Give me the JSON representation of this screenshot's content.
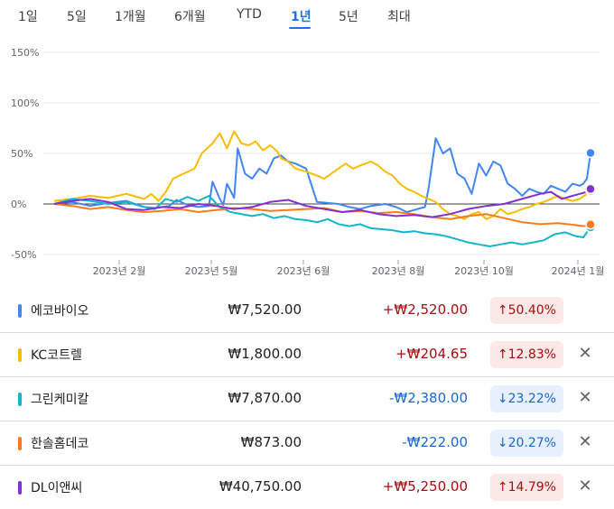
{
  "tabs": [
    {
      "label": "1일",
      "active": false
    },
    {
      "label": "5일",
      "active": false
    },
    {
      "label": "1개월",
      "active": false
    },
    {
      "label": "6개월",
      "active": false
    },
    {
      "label": "YTD",
      "active": false
    },
    {
      "label": "1년",
      "active": true
    },
    {
      "label": "5년",
      "active": false
    },
    {
      "label": "최대",
      "active": false
    }
  ],
  "chart_data": {
    "type": "line",
    "yticks": [
      "150%",
      "100%",
      "50%",
      "0%",
      "-50%"
    ],
    "ylim": [
      -50,
      150
    ],
    "x_labels": [
      "2023년 2월",
      "2023년 5월",
      "2023년 6월",
      "2023년 8월",
      "2023년 10월",
      "2024년 1월"
    ],
    "grid": true,
    "series": [
      {
        "name": "에코바이오",
        "color": "#4285f4",
        "points": [
          [
            0,
            0
          ],
          [
            5,
            2
          ],
          [
            10,
            -2
          ],
          [
            15,
            1
          ],
          [
            20,
            3
          ],
          [
            25,
            -3
          ],
          [
            28,
            -4
          ],
          [
            32,
            -2
          ],
          [
            34,
            4
          ],
          [
            37,
            -1
          ],
          [
            40,
            -3
          ],
          [
            43,
            -2
          ],
          [
            44,
            22
          ],
          [
            46,
            5
          ],
          [
            47,
            -1
          ],
          [
            48,
            20
          ],
          [
            50,
            6
          ],
          [
            51,
            55
          ],
          [
            53,
            30
          ],
          [
            55,
            25
          ],
          [
            57,
            35
          ],
          [
            59,
            30
          ],
          [
            61,
            45
          ],
          [
            63,
            48
          ],
          [
            65,
            42
          ],
          [
            67,
            40
          ],
          [
            70,
            35
          ],
          [
            73,
            2
          ],
          [
            76,
            1
          ],
          [
            79,
            0
          ],
          [
            82,
            -3
          ],
          [
            85,
            -5
          ],
          [
            88,
            -2
          ],
          [
            92,
            0
          ],
          [
            95,
            -3
          ],
          [
            98,
            -8
          ],
          [
            101,
            -5
          ],
          [
            103,
            -3
          ],
          [
            104,
            15
          ],
          [
            106,
            65
          ],
          [
            108,
            50
          ],
          [
            110,
            55
          ],
          [
            112,
            30
          ],
          [
            114,
            25
          ],
          [
            116,
            10
          ],
          [
            118,
            40
          ],
          [
            120,
            28
          ],
          [
            122,
            42
          ],
          [
            124,
            38
          ],
          [
            126,
            20
          ],
          [
            128,
            15
          ],
          [
            130,
            8
          ],
          [
            132,
            15
          ],
          [
            134,
            12
          ],
          [
            136,
            10
          ],
          [
            138,
            18
          ],
          [
            140,
            15
          ],
          [
            142,
            12
          ],
          [
            144,
            20
          ],
          [
            146,
            18
          ],
          [
            147,
            20
          ],
          [
            148,
            25
          ],
          [
            149,
            50.4
          ]
        ]
      },
      {
        "name": "KC코트렐",
        "color": "#fbbc04",
        "points": [
          [
            0,
            3
          ],
          [
            5,
            5
          ],
          [
            10,
            8
          ],
          [
            15,
            6
          ],
          [
            20,
            10
          ],
          [
            25,
            5
          ],
          [
            27,
            10
          ],
          [
            29,
            3
          ],
          [
            31,
            12
          ],
          [
            33,
            25
          ],
          [
            36,
            30
          ],
          [
            39,
            35
          ],
          [
            41,
            50
          ],
          [
            44,
            60
          ],
          [
            46,
            70
          ],
          [
            48,
            55
          ],
          [
            50,
            72
          ],
          [
            52,
            60
          ],
          [
            54,
            58
          ],
          [
            56,
            62
          ],
          [
            58,
            53
          ],
          [
            60,
            58
          ],
          [
            62,
            52
          ],
          [
            63,
            45
          ],
          [
            65,
            42
          ],
          [
            67,
            35
          ],
          [
            70,
            32
          ],
          [
            73,
            28
          ],
          [
            75,
            25
          ],
          [
            77,
            30
          ],
          [
            79,
            35
          ],
          [
            81,
            40
          ],
          [
            83,
            35
          ],
          [
            85,
            38
          ],
          [
            88,
            42
          ],
          [
            90,
            38
          ],
          [
            92,
            32
          ],
          [
            94,
            28
          ],
          [
            96,
            20
          ],
          [
            98,
            15
          ],
          [
            100,
            12
          ],
          [
            102,
            8
          ],
          [
            104,
            5
          ],
          [
            106,
            2
          ],
          [
            108,
            -5
          ],
          [
            110,
            -10
          ],
          [
            112,
            -12
          ],
          [
            114,
            -15
          ],
          [
            116,
            -10
          ],
          [
            118,
            -8
          ],
          [
            120,
            -15
          ],
          [
            122,
            -12
          ],
          [
            124,
            -5
          ],
          [
            126,
            -10
          ],
          [
            128,
            -8
          ],
          [
            130,
            -5
          ],
          [
            132,
            -3
          ],
          [
            134,
            0
          ],
          [
            136,
            2
          ],
          [
            138,
            5
          ],
          [
            140,
            8
          ],
          [
            142,
            5
          ],
          [
            144,
            3
          ],
          [
            146,
            5
          ],
          [
            148,
            10
          ],
          [
            149,
            12.83
          ]
        ]
      },
      {
        "name": "그린케미칼",
        "color": "#12b5cb",
        "points": [
          [
            0,
            0
          ],
          [
            5,
            5
          ],
          [
            10,
            3
          ],
          [
            15,
            0
          ],
          [
            20,
            2
          ],
          [
            25,
            -3
          ],
          [
            28,
            -5
          ],
          [
            31,
            5
          ],
          [
            34,
            2
          ],
          [
            37,
            7
          ],
          [
            40,
            3
          ],
          [
            43,
            8
          ],
          [
            46,
            -3
          ],
          [
            49,
            -8
          ],
          [
            52,
            -10
          ],
          [
            55,
            -12
          ],
          [
            58,
            -10
          ],
          [
            61,
            -14
          ],
          [
            64,
            -12
          ],
          [
            67,
            -15
          ],
          [
            70,
            -16
          ],
          [
            73,
            -18
          ],
          [
            76,
            -15
          ],
          [
            79,
            -20
          ],
          [
            82,
            -22
          ],
          [
            85,
            -20
          ],
          [
            88,
            -24
          ],
          [
            91,
            -25
          ],
          [
            94,
            -26
          ],
          [
            97,
            -28
          ],
          [
            100,
            -27
          ],
          [
            103,
            -29
          ],
          [
            106,
            -30
          ],
          [
            109,
            -32
          ],
          [
            112,
            -35
          ],
          [
            115,
            -38
          ],
          [
            118,
            -40
          ],
          [
            121,
            -42
          ],
          [
            124,
            -40
          ],
          [
            127,
            -38
          ],
          [
            130,
            -40
          ],
          [
            133,
            -38
          ],
          [
            136,
            -36
          ],
          [
            139,
            -30
          ],
          [
            142,
            -28
          ],
          [
            145,
            -32
          ],
          [
            147,
            -33
          ],
          [
            149,
            -23.22
          ]
        ]
      },
      {
        "name": "한솔홈데코",
        "color": "#fa7b17",
        "points": [
          [
            0,
            0
          ],
          [
            5,
            -2
          ],
          [
            10,
            -5
          ],
          [
            15,
            -3
          ],
          [
            20,
            -6
          ],
          [
            25,
            -8
          ],
          [
            30,
            -7
          ],
          [
            35,
            -5
          ],
          [
            40,
            -8
          ],
          [
            45,
            -6
          ],
          [
            50,
            -4
          ],
          [
            55,
            -5
          ],
          [
            60,
            -7
          ],
          [
            65,
            -6
          ],
          [
            70,
            -5
          ],
          [
            75,
            -4
          ],
          [
            80,
            -8
          ],
          [
            85,
            -7
          ],
          [
            90,
            -9
          ],
          [
            95,
            -8
          ],
          [
            100,
            -10
          ],
          [
            105,
            -13
          ],
          [
            110,
            -15
          ],
          [
            115,
            -12
          ],
          [
            120,
            -10
          ],
          [
            125,
            -14
          ],
          [
            130,
            -18
          ],
          [
            135,
            -20
          ],
          [
            140,
            -19
          ],
          [
            145,
            -21
          ],
          [
            147,
            -22
          ],
          [
            149,
            -20.27
          ]
        ]
      },
      {
        "name": "DL이앤씨",
        "color": "#8430ce",
        "points": [
          [
            0,
            0
          ],
          [
            5,
            3
          ],
          [
            10,
            5
          ],
          [
            15,
            2
          ],
          [
            20,
            -5
          ],
          [
            25,
            -6
          ],
          [
            30,
            -3
          ],
          [
            35,
            -4
          ],
          [
            40,
            0
          ],
          [
            45,
            -2
          ],
          [
            50,
            -5
          ],
          [
            55,
            -3
          ],
          [
            60,
            2
          ],
          [
            65,
            4
          ],
          [
            70,
            -2
          ],
          [
            75,
            -5
          ],
          [
            80,
            -8
          ],
          [
            85,
            -6
          ],
          [
            90,
            -10
          ],
          [
            95,
            -12
          ],
          [
            100,
            -11
          ],
          [
            105,
            -13
          ],
          [
            110,
            -10
          ],
          [
            115,
            -5
          ],
          [
            120,
            -2
          ],
          [
            125,
            0
          ],
          [
            130,
            5
          ],
          [
            135,
            10
          ],
          [
            138,
            12
          ],
          [
            141,
            5
          ],
          [
            144,
            8
          ],
          [
            146,
            10
          ],
          [
            148,
            12
          ],
          [
            149,
            14.79
          ]
        ]
      }
    ]
  },
  "rows": [
    {
      "name": "에코바이오",
      "color": "#4285f4",
      "price": "₩7,520.00",
      "change": "+₩2,520.00",
      "dir": "up",
      "pct": "↑50.40%",
      "closable": false
    },
    {
      "name": "KC코트렐",
      "color": "#fbbc04",
      "price": "₩1,800.00",
      "change": "+₩204.65",
      "dir": "up",
      "pct": "↑12.83%",
      "closable": true
    },
    {
      "name": "그린케미칼",
      "color": "#12b5cb",
      "price": "₩7,870.00",
      "change": "-₩2,380.00",
      "dir": "down",
      "pct": "↓23.22%",
      "closable": true
    },
    {
      "name": "한솔홈데코",
      "color": "#fa7b17",
      "price": "₩873.00",
      "change": "-₩222.00",
      "dir": "down",
      "pct": "↓20.27%",
      "closable": true
    },
    {
      "name": "DL이앤씨",
      "color": "#8430ce",
      "price": "₩40,750.00",
      "change": "+₩5,250.00",
      "dir": "up",
      "pct": "↑14.79%",
      "closable": true
    }
  ],
  "close_glyph": "✕"
}
